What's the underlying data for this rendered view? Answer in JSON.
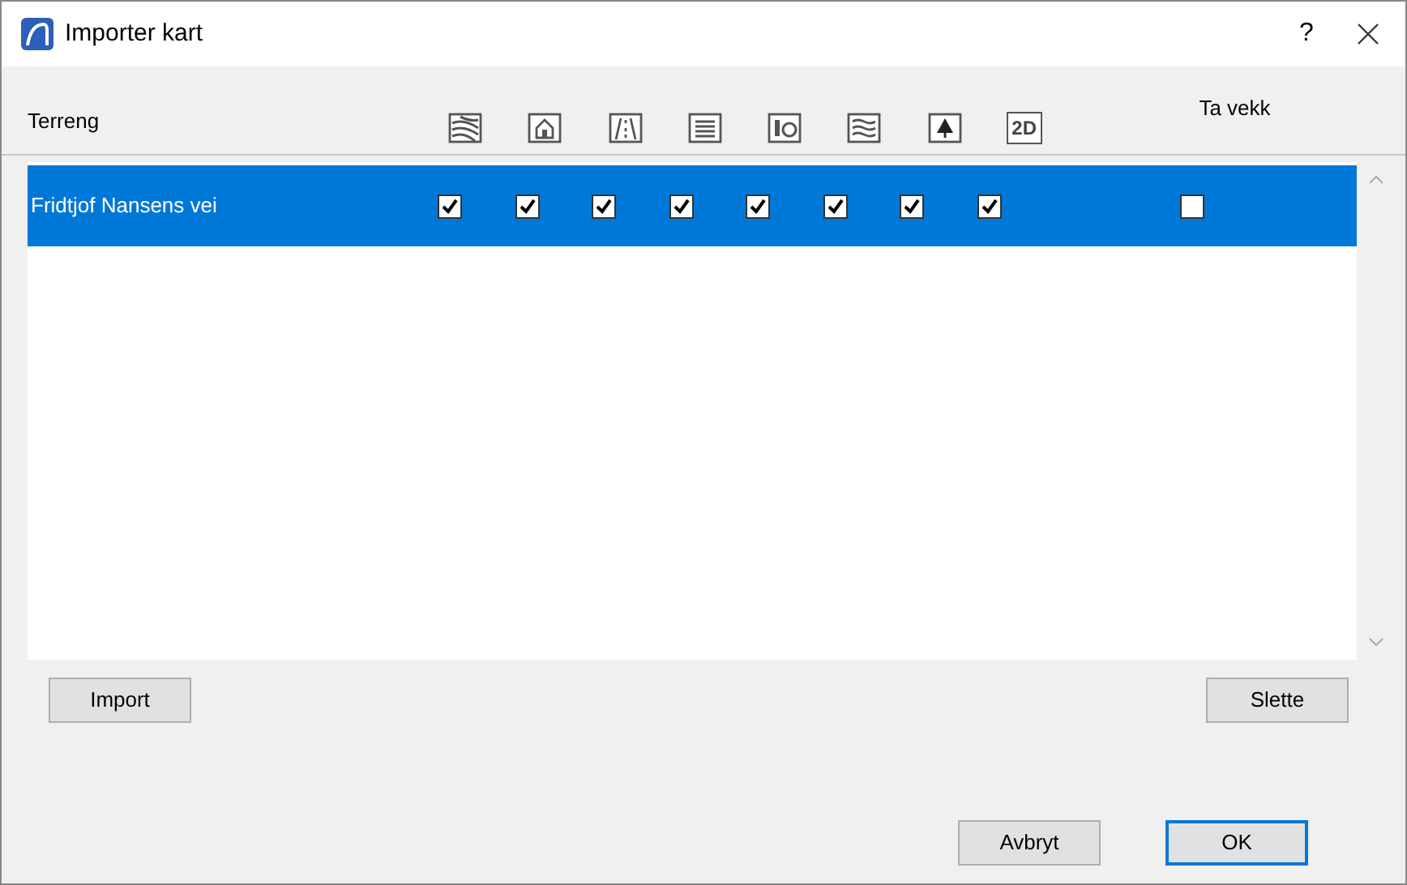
{
  "window": {
    "title": "Importer kart",
    "help": "?"
  },
  "table": {
    "name_column": "Terreng",
    "layer_columns": [
      {
        "kind": "terrain"
      },
      {
        "kind": "building"
      },
      {
        "kind": "road"
      },
      {
        "kind": "wall"
      },
      {
        "kind": "objects"
      },
      {
        "kind": "water"
      },
      {
        "kind": "tree"
      },
      {
        "kind": "text",
        "label": "2D"
      }
    ],
    "remove_column": "Ta vekk",
    "rows": [
      {
        "name": "Fridtjof Nansens vei",
        "selected": true,
        "layers": [
          {
            "checked": true
          },
          {
            "checked": true
          },
          {
            "checked": true
          },
          {
            "checked": true
          },
          {
            "checked": true
          },
          {
            "checked": true
          },
          {
            "checked": true
          },
          {
            "checked": true
          }
        ],
        "remove": {
          "checked": false
        }
      }
    ]
  },
  "list_buttons": [
    "Import",
    "Slette"
  ],
  "dialog_buttons": [
    {
      "label": "Avbryt",
      "default": false
    },
    {
      "label": "OK",
      "default": true
    }
  ]
}
